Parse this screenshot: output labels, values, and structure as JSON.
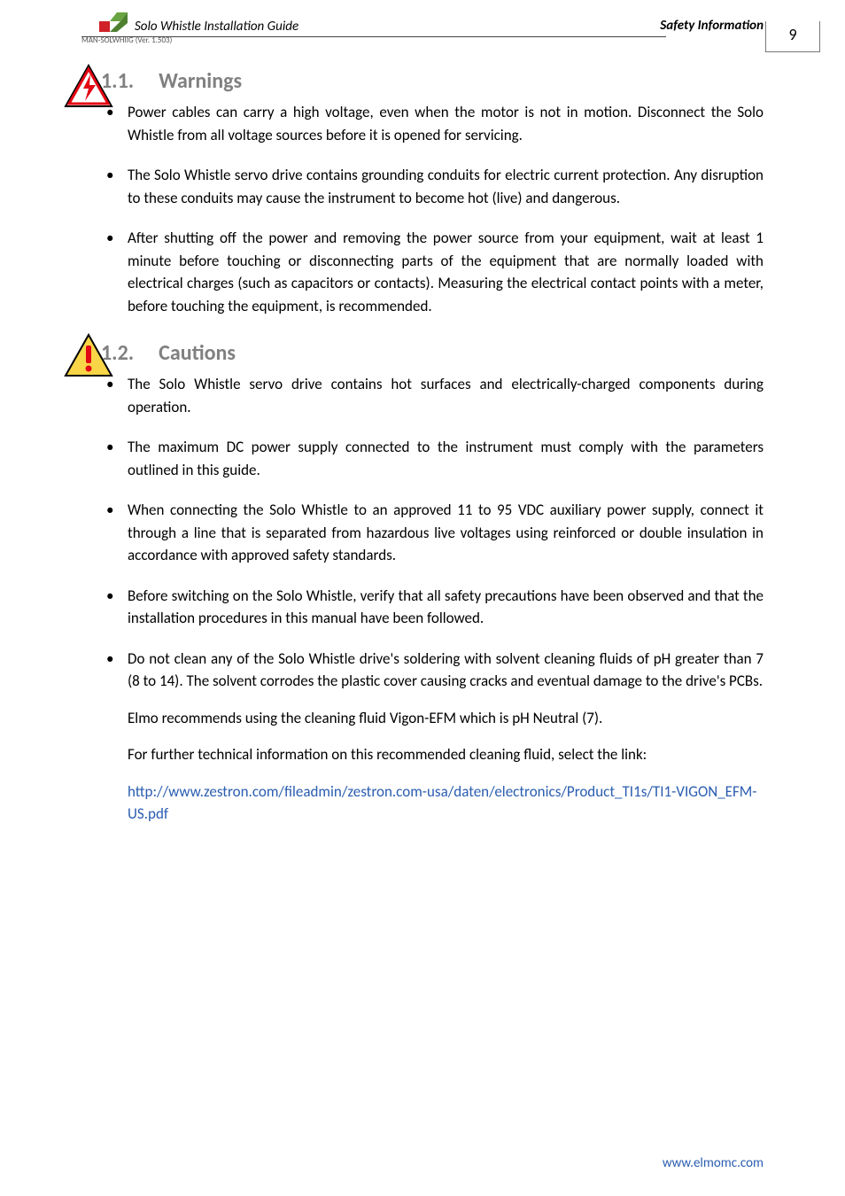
{
  "header": {
    "doc_title": "Solo Whistle Installation Guide",
    "section_label": "Safety Information",
    "version_note": "MAN-SOLWHIIG (Ver. 1.503)",
    "page_number": "9"
  },
  "sections": {
    "warnings": {
      "number": "1.1.",
      "title": "Warnings",
      "items": [
        "Power cables can carry a high voltage, even when the motor is not in motion. Disconnect the Solo Whistle from all voltage sources before it is opened for servicing.",
        "The Solo Whistle servo drive contains grounding conduits for electric current protection. Any disruption to these conduits may cause the instrument to become hot (live) and dangerous.",
        "After shutting off the power and removing the power source from your equipment, wait at least 1 minute before touching or disconnecting parts of the equipment that are normally loaded with electrical charges (such as capacitors or contacts). Measuring the electrical contact points with a meter, before touching the equipment, is recommended."
      ]
    },
    "cautions": {
      "number": "1.2.",
      "title": "Cautions",
      "items": [
        "The Solo Whistle servo drive contains hot surfaces and electrically-charged components during operation.",
        "The maximum DC power supply connected to the instrument must comply with the parameters outlined in this guide.",
        "When connecting the Solo Whistle to an approved 11 to 95 VDC auxiliary power supply, connect it through a line that is separated from hazardous live voltages using reinforced or double insulation in accordance with approved safety standards.",
        "Before switching on the Solo Whistle, verify that all safety precautions have been observed and that the installation procedures in this manual have been followed."
      ],
      "last_item": {
        "main": "Do not clean any of the Solo Whistle drive's soldering with solvent cleaning fluids of pH greater than 7 (8 to 14). The solvent corrodes the plastic cover causing cracks and eventual damage to the drive's PCBs.",
        "p1": "Elmo recommends using the cleaning fluid Vigon-EFM which is pH Neutral (7).",
        "p2": "For further technical information on this recommended cleaning fluid, select the link:",
        "link": "http://www.zestron.com/fileadmin/zestron.com-usa/daten/electronics/Product_TI1s/TI1-VIGON_EFM-US.pdf"
      }
    }
  },
  "footer": {
    "url": "www.elmomc.com"
  },
  "icons": {
    "logo": "elmo-logo",
    "warning": "high-voltage-icon",
    "caution": "caution-icon"
  }
}
